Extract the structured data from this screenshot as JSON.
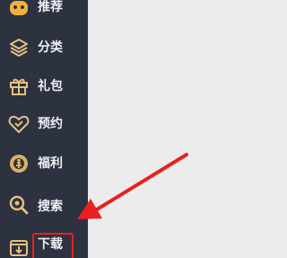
{
  "sidebar": {
    "items": [
      {
        "label": "推荐",
        "icon": "recommend-icon"
      },
      {
        "label": "分类",
        "icon": "category-icon"
      },
      {
        "label": "礼包",
        "icon": "gift-icon"
      },
      {
        "label": "预约",
        "icon": "reservation-icon"
      },
      {
        "label": "福利",
        "icon": "welfare-icon"
      },
      {
        "label": "搜索",
        "icon": "search-icon"
      },
      {
        "label": "下载",
        "icon": "download-icon"
      }
    ]
  },
  "colors": {
    "sidebar_bg": "#2c3240",
    "icon_accent": "#f0b43c",
    "annotation_red": "#e8201f"
  }
}
